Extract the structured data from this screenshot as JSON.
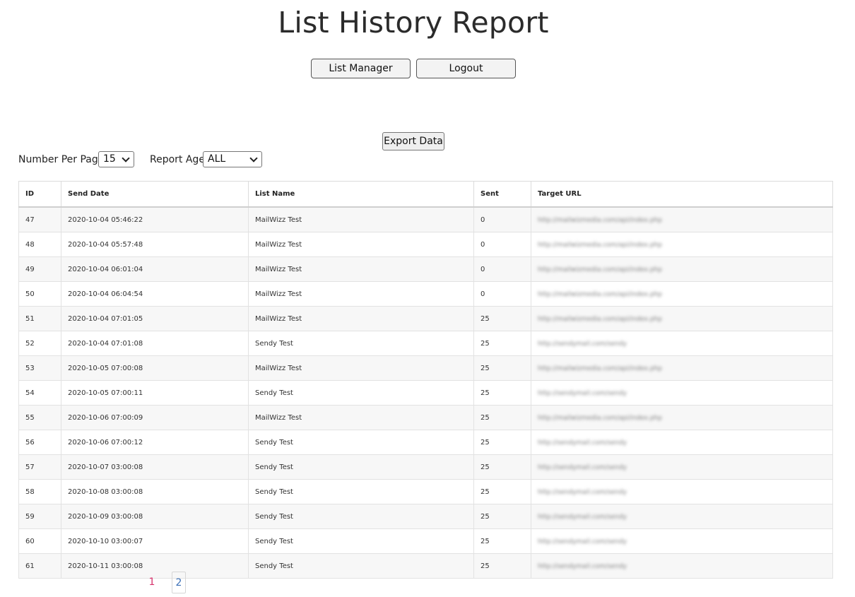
{
  "page": {
    "title": "List History Report"
  },
  "nav": {
    "list_manager_label": "List Manager",
    "logout_label": "Logout"
  },
  "toolbar": {
    "export_label": "Export Data"
  },
  "controls": {
    "per_page_label": "Number Per Page:",
    "per_page_value": "15",
    "report_age_label": "Report Age:",
    "report_age_value": "ALL"
  },
  "table": {
    "columns": [
      "ID",
      "Send Date",
      "List Name",
      "Sent",
      "Target URL"
    ],
    "rows": [
      {
        "id": "47",
        "date": "2020-10-04 05:46:22",
        "list": "MailWizz Test",
        "sent": "0",
        "url": "http://mailwizmedia.com/api/index.php"
      },
      {
        "id": "48",
        "date": "2020-10-04 05:57:48",
        "list": "MailWizz Test",
        "sent": "0",
        "url": "http://mailwizmedia.com/api/index.php"
      },
      {
        "id": "49",
        "date": "2020-10-04 06:01:04",
        "list": "MailWizz Test",
        "sent": "0",
        "url": "http://mailwizmedia.com/api/index.php"
      },
      {
        "id": "50",
        "date": "2020-10-04 06:04:54",
        "list": "MailWizz Test",
        "sent": "0",
        "url": "http://mailwizmedia.com/api/index.php"
      },
      {
        "id": "51",
        "date": "2020-10-04 07:01:05",
        "list": "MailWizz Test",
        "sent": "25",
        "url": "http://mailwizmedia.com/api/index.php"
      },
      {
        "id": "52",
        "date": "2020-10-04 07:01:08",
        "list": "Sendy Test",
        "sent": "25",
        "url": "http://sendymail.com/sendy"
      },
      {
        "id": "53",
        "date": "2020-10-05 07:00:08",
        "list": "MailWizz Test",
        "sent": "25",
        "url": "http://mailwizmedia.com/api/index.php"
      },
      {
        "id": "54",
        "date": "2020-10-05 07:00:11",
        "list": "Sendy Test",
        "sent": "25",
        "url": "http://sendymail.com/sendy"
      },
      {
        "id": "55",
        "date": "2020-10-06 07:00:09",
        "list": "MailWizz Test",
        "sent": "25",
        "url": "http://mailwizmedia.com/api/index.php"
      },
      {
        "id": "56",
        "date": "2020-10-06 07:00:12",
        "list": "Sendy Test",
        "sent": "25",
        "url": "http://sendymail.com/sendy"
      },
      {
        "id": "57",
        "date": "2020-10-07 03:00:08",
        "list": "Sendy Test",
        "sent": "25",
        "url": "http://sendymail.com/sendy"
      },
      {
        "id": "58",
        "date": "2020-10-08 03:00:08",
        "list": "Sendy Test",
        "sent": "25",
        "url": "http://sendymail.com/sendy"
      },
      {
        "id": "59",
        "date": "2020-10-09 03:00:08",
        "list": "Sendy Test",
        "sent": "25",
        "url": "http://sendymail.com/sendy"
      },
      {
        "id": "60",
        "date": "2020-10-10 03:00:07",
        "list": "Sendy Test",
        "sent": "25",
        "url": "http://sendymail.com/sendy"
      },
      {
        "id": "61",
        "date": "2020-10-11 03:00:08",
        "list": "Sendy Test",
        "sent": "25",
        "url": "http://sendymail.com/sendy"
      }
    ]
  },
  "pagination": {
    "pages": [
      "1",
      "2"
    ],
    "current": "2"
  }
}
